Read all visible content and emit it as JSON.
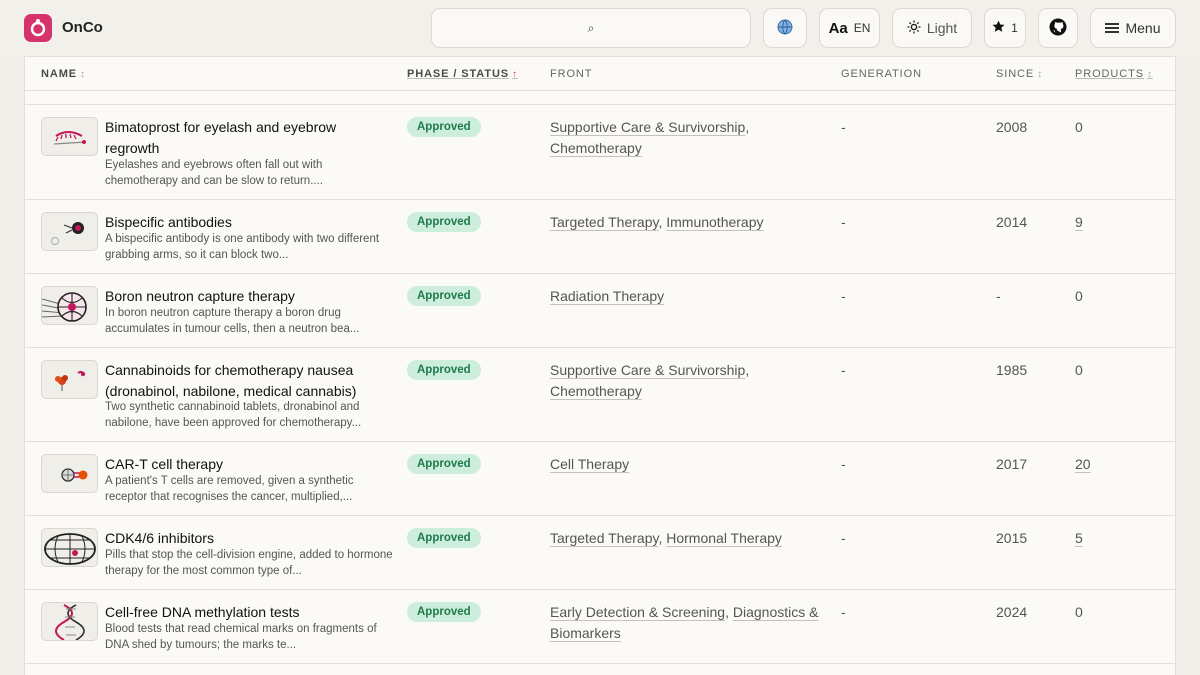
{
  "brand": {
    "name": "OnCo"
  },
  "header": {
    "search_icon": "⌕",
    "search_placeholder": "",
    "globe_icon": "globe-icon",
    "lang_aa": "Aa",
    "lang_code": "EN",
    "theme_label": "Light",
    "stars_count": "1",
    "menu_label": "Menu"
  },
  "table": {
    "columns": {
      "name": "NAME",
      "phase": "PHASE / STATUS",
      "front": "FRONT",
      "generation": "GENERATION",
      "since": "SINCE",
      "products": "PRODUCTS"
    },
    "rows": [
      {
        "title": "Bimatoprost for eyelash and eyebrow regrowth",
        "desc": "Eyelashes and eyebrows often fall out with chemotherapy and can be slow to return....",
        "status": "Approved",
        "front_a": "Supportive Care & Survivorship",
        "front_b": "Chemotherapy",
        "generation": "-",
        "since": "2008",
        "products": "0"
      },
      {
        "title": "Bispecific antibodies",
        "desc": "A bispecific antibody is one antibody with two different grabbing arms, so it can block two...",
        "status": "Approved",
        "front_a": "Targeted Therapy",
        "front_b": "Immunotherapy",
        "generation": "-",
        "since": "2014",
        "products": "9"
      },
      {
        "title": "Boron neutron capture therapy",
        "desc": "In boron neutron capture therapy a boron drug accumulates in tumour cells, then a neutron bea...",
        "status": "Approved",
        "front_a": "Radiation Therapy",
        "front_b": "",
        "generation": "-",
        "since": "-",
        "products": "0"
      },
      {
        "title": "Cannabinoids for chemotherapy nausea (dronabinol, nabilone, medical cannabis)",
        "desc": "Two synthetic cannabinoid tablets, dronabinol and nabilone, have been approved for chemotherapy...",
        "status": "Approved",
        "front_a": "Supportive Care & Survivorship",
        "front_b": "Chemotherapy",
        "generation": "-",
        "since": "1985",
        "products": "0"
      },
      {
        "title": "CAR-T cell therapy",
        "desc": "A patient's T cells are removed, given a synthetic receptor that recognises the cancer, multiplied,...",
        "status": "Approved",
        "front_a": "Cell Therapy",
        "front_b": "",
        "generation": "-",
        "since": "2017",
        "products": "20"
      },
      {
        "title": "CDK4/6 inhibitors",
        "desc": "Pills that stop the cell-division engine, added to hormone therapy for the most common type of...",
        "status": "Approved",
        "front_a": "Targeted Therapy",
        "front_b": "Hormonal Therapy",
        "generation": "-",
        "since": "2015",
        "products": "5"
      },
      {
        "title": "Cell-free DNA methylation tests",
        "desc": "Blood tests that read chemical marks on fragments of DNA shed by tumours; the marks te...",
        "status": "Approved",
        "front_a": "Early Detection & Screening",
        "front_b": "Diagnostics & Biomarkers",
        "generation": "-",
        "since": "2024",
        "products": "0"
      }
    ]
  },
  "colors": {
    "accent": "#d6336c",
    "approved_bg": "#cdeedd",
    "approved_text": "#1f7a4a",
    "page_bg": "#f1efe9"
  }
}
